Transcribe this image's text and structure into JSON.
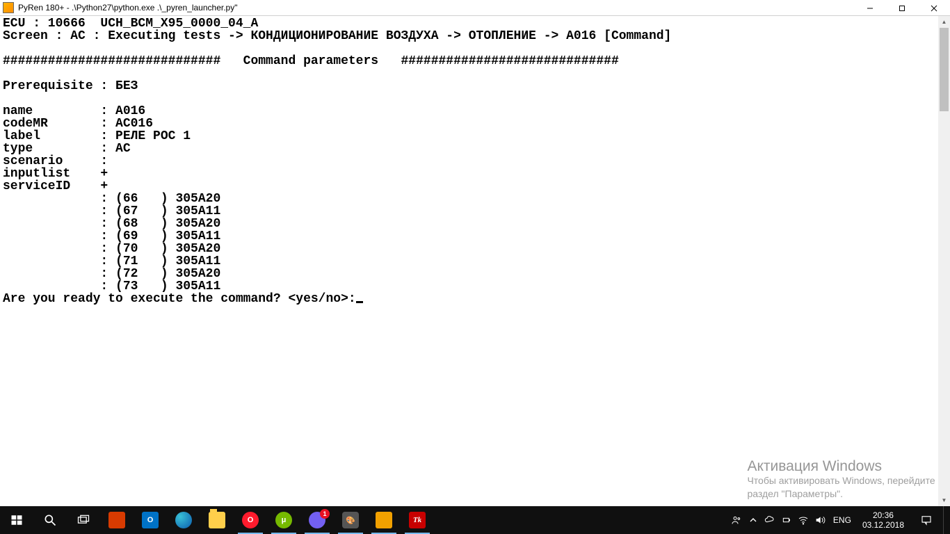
{
  "window": {
    "title": "PyRen 180+ - .\\Python27\\python.exe  .\\_pyren_launcher.py\""
  },
  "console": {
    "ecu_line": "ECU : 10666  UCH_BCM_X95_0000_04_A",
    "screen_line": "Screen : AC : Executing tests -> КОНДИЦИОНИРОВАНИЕ ВОЗДУХА -> ОТОПЛЕНИЕ -> A016 [Command]",
    "blank": "",
    "sep_line": "#############################   Command parameters   #############################",
    "prereq_line": "Prerequisite : БЕЗ",
    "name_line": "name         : A016",
    "codemr_line": "codeMR       : AC016",
    "label_line": "label        : РЕЛЕ РОС 1",
    "type_line": "type         : AC",
    "scenario_line": "scenario     :",
    "inputlist_line": "inputlist    +",
    "serviceid_line": "serviceID    +",
    "svc_1": "             : (66   ) 305A20",
    "svc_2": "             : (67   ) 305A11",
    "svc_3": "             : (68   ) 305A20",
    "svc_4": "             : (69   ) 305A11",
    "svc_5": "             : (70   ) 305A20",
    "svc_6": "             : (71   ) 305A11",
    "svc_7": "             : (72   ) 305A20",
    "svc_8": "             : (73   ) 305A11",
    "prompt": "Are you ready to execute the command? <yes/no>:"
  },
  "watermark": {
    "title": "Активация Windows",
    "line1": "Чтобы активировать Windows, перейдите в",
    "line2": "раздел \"Параметры\"."
  },
  "taskbar": {
    "lang": "ENG",
    "time": "20:36",
    "date": "03.12.2018",
    "viber_badge": "1"
  }
}
